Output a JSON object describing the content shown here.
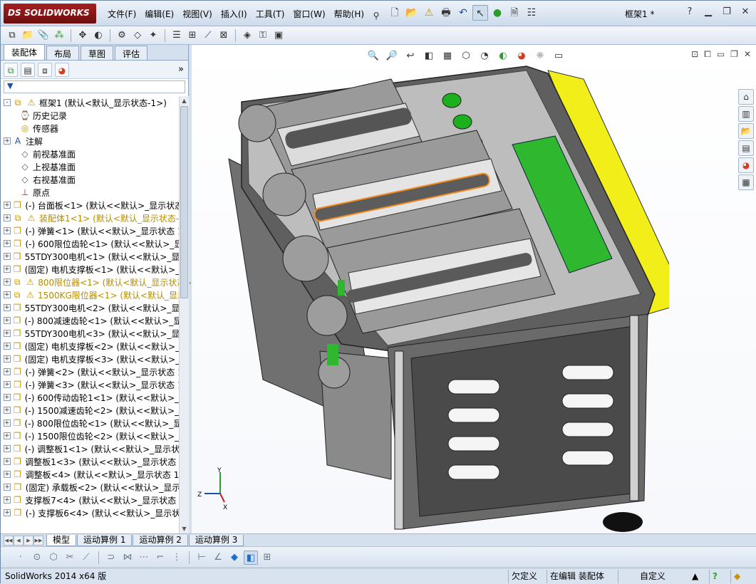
{
  "app": {
    "logo_text": "SOLIDWORKS",
    "logo_prefix": "DS",
    "document_title": "框架1 *"
  },
  "menu": {
    "items": [
      "文件(F)",
      "编辑(E)",
      "视图(V)",
      "插入(I)",
      "工具(T)",
      "窗口(W)",
      "帮助(H)"
    ]
  },
  "feature_manager": {
    "tabs": [
      "装配体",
      "布局",
      "草图",
      "评估"
    ],
    "active_tab": "装配体",
    "filter_icon": "filter-icon",
    "tree": [
      {
        "label": "框架1 (默认<默认_显示状态-1>)",
        "icon": "assembly-icon",
        "expand": "-",
        "warn": true,
        "root": true
      },
      {
        "label": "历史记录",
        "icon": "history-icon",
        "expand": ""
      },
      {
        "label": "传感器",
        "icon": "sensor-icon",
        "expand": ""
      },
      {
        "label": "注解",
        "icon": "annotation-icon",
        "expand": "+"
      },
      {
        "label": "前视基准面",
        "icon": "plane-icon",
        "expand": ""
      },
      {
        "label": "上视基准面",
        "icon": "plane-icon",
        "expand": ""
      },
      {
        "label": "右视基准面",
        "icon": "plane-icon",
        "expand": ""
      },
      {
        "label": "原点",
        "icon": "origin-icon",
        "expand": ""
      },
      {
        "label": "(-) 台面板<1> (默认<<默认>_显示状态",
        "icon": "part-icon",
        "expand": "+"
      },
      {
        "label": "装配体1<1> (默认<默认_显示状态-",
        "icon": "subassembly-icon",
        "expand": "+",
        "warn": true
      },
      {
        "label": "(-) 弹簧<1> (默认<<默认>_显示状态 1",
        "icon": "part-icon",
        "expand": "+"
      },
      {
        "label": "(-) 600限位齿轮<1> (默认<<默认>_显",
        "icon": "part-icon",
        "expand": "+"
      },
      {
        "label": "55TDY300电机<1> (默认<<默认>_显示",
        "icon": "part-icon",
        "expand": "+"
      },
      {
        "label": "(固定) 电机支撑板<1> (默认<<默认>_显",
        "icon": "part-icon",
        "expand": "+"
      },
      {
        "label": "800限位器<1> (默认<默认_显示状态",
        "icon": "subassembly-icon",
        "expand": "+",
        "warn": true
      },
      {
        "label": "1500KG限位器<1> (默认<默认_显示",
        "icon": "subassembly-icon",
        "expand": "+",
        "warn": true
      },
      {
        "label": "55TDY300电机<2> (默认<<默认>_显示",
        "icon": "part-icon",
        "expand": "+"
      },
      {
        "label": "(-) 800减速齿轮<1> (默认<<默认>_显示",
        "icon": "part-icon",
        "expand": "+"
      },
      {
        "label": "55TDY300电机<3> (默认<<默认>_显示",
        "icon": "part-icon",
        "expand": "+"
      },
      {
        "label": "(固定) 电机支撑板<2> (默认<<默认>_显",
        "icon": "part-icon",
        "expand": "+"
      },
      {
        "label": "(固定) 电机支撑板<3> (默认<<默认>_显",
        "icon": "part-icon",
        "expand": "+"
      },
      {
        "label": "(-) 弹簧<2> (默认<<默认>_显示状态 1",
        "icon": "part-icon",
        "expand": "+"
      },
      {
        "label": "(-) 弹簧<3> (默认<<默认>_显示状态 1",
        "icon": "part-icon",
        "expand": "+"
      },
      {
        "label": "(-) 600传动齿轮1<1> (默认<<默认>_显",
        "icon": "part-icon",
        "expand": "+"
      },
      {
        "label": "(-) 1500减速齿轮<2> (默认<<默认>_显",
        "icon": "part-icon",
        "expand": "+"
      },
      {
        "label": "(-) 800限位齿轮<1> (默认<<默认>_显示",
        "icon": "part-icon",
        "expand": "+"
      },
      {
        "label": "(-) 1500限位齿轮<2> (默认<<默认>_显",
        "icon": "part-icon",
        "expand": "+"
      },
      {
        "label": "(-) 调整板1<1> (默认<<默认>_显示状态",
        "icon": "part-icon",
        "expand": "+"
      },
      {
        "label": "调整板1<3> (默认<<默认>_显示状态 1",
        "icon": "part-icon",
        "expand": "+"
      },
      {
        "label": "调整板<4> (默认<<默认>_显示状态 1:",
        "icon": "part-icon",
        "expand": "+"
      },
      {
        "label": "(固定) 承载板<2> (默认<<默认>_显示",
        "icon": "part-icon",
        "expand": "+"
      },
      {
        "label": "支撑板7<4> (默认<<默认>_显示状态 1",
        "icon": "part-icon",
        "expand": "+"
      },
      {
        "label": "(-) 支撑板6<4> (默认<<默认>_显示状",
        "icon": "part-icon",
        "expand": "+"
      }
    ]
  },
  "bottom_tabs": [
    "模型",
    "运动算例 1",
    "运动算例 2",
    "运动算例 3"
  ],
  "active_bottom_tab": "模型",
  "statusbar": {
    "left": "SolidWorks 2014 x64 版",
    "undefined": "欠定义",
    "editing": "在编辑 装配体",
    "custom": "自定义",
    "help": "?"
  },
  "triad": {
    "x": "X",
    "y": "Y",
    "z": "Z"
  },
  "colors": {
    "accent_red": "#9b1a1a",
    "plate_gray": "#7d7d7d",
    "pcb_green": "#2fb82f",
    "yellow_edge": "#f2ee1a",
    "selection_orange": "#f08a1c"
  }
}
